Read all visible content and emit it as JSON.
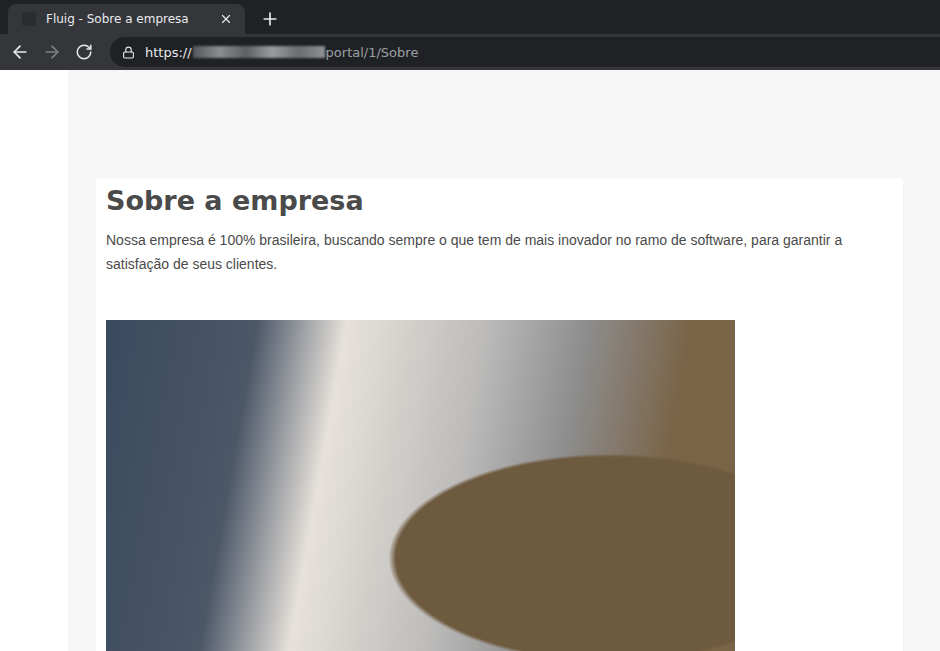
{
  "browser": {
    "tabs": [
      {
        "title": "Fluig - Sobre a empresa",
        "selected": true
      }
    ],
    "nav": {
      "back_enabled": true,
      "forward_enabled": false
    },
    "address": {
      "scheme": "https://",
      "path": "portal/1/Sobre",
      "secure": true
    }
  },
  "page": {
    "heading": "Sobre a empresa",
    "paragraph": "Nossa empresa é 100% brasileira, buscando sempre o que tem de mais inovador no ramo de software, para garantir a satisfação de seus clientes."
  }
}
